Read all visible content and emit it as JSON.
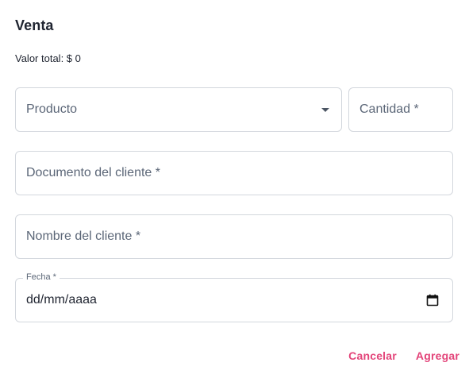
{
  "dialog": {
    "title": "Venta",
    "total_label": "Valor total: $ 0"
  },
  "form": {
    "producto": {
      "placeholder": "Producto"
    },
    "cantidad": {
      "placeholder": "Cantidad *"
    },
    "documento": {
      "placeholder": "Documento del cliente *"
    },
    "nombre": {
      "placeholder": "Nombre del cliente *"
    },
    "fecha": {
      "label": "Fecha *",
      "value": "dd/mm/aaaa"
    }
  },
  "actions": {
    "cancel_label": "Cancelar",
    "add_label": "Agregar"
  },
  "colors": {
    "accent": "#e3457a",
    "border": "#d3d7dd",
    "placeholder": "#5b6677"
  },
  "icons": {
    "dropdown": "chevron-down-icon",
    "calendar": "calendar-icon"
  }
}
